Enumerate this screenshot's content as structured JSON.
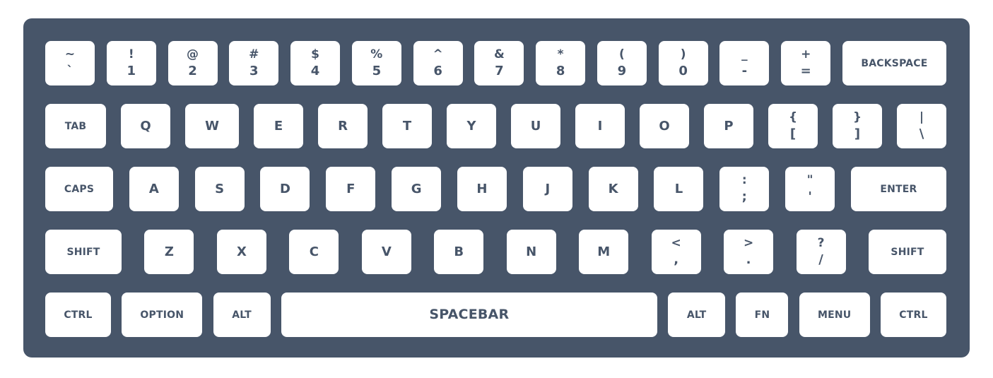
{
  "keyboard": {
    "rows": [
      [
        {
          "top": "~",
          "bottom": "`"
        },
        {
          "top": "!",
          "bottom": "1"
        },
        {
          "top": "@",
          "bottom": "2"
        },
        {
          "top": "#",
          "bottom": "3"
        },
        {
          "top": "$",
          "bottom": "4"
        },
        {
          "top": "%",
          "bottom": "5"
        },
        {
          "top": "^",
          "bottom": "6"
        },
        {
          "top": "&",
          "bottom": "7"
        },
        {
          "top": "*",
          "bottom": "8"
        },
        {
          "top": "(",
          "bottom": "9"
        },
        {
          "top": ")",
          "bottom": "0"
        },
        {
          "top": "_",
          "bottom": "-"
        },
        {
          "top": "+",
          "bottom": "="
        },
        {
          "label": "BACKSPACE"
        }
      ],
      [
        {
          "label": "TAB"
        },
        {
          "label": "Q"
        },
        {
          "label": "W"
        },
        {
          "label": "E"
        },
        {
          "label": "R"
        },
        {
          "label": "T"
        },
        {
          "label": "Y"
        },
        {
          "label": "U"
        },
        {
          "label": "I"
        },
        {
          "label": "O"
        },
        {
          "label": "P"
        },
        {
          "top": "{",
          "bottom": "["
        },
        {
          "top": "}",
          "bottom": "]"
        },
        {
          "top": "|",
          "bottom": "\\"
        }
      ],
      [
        {
          "label": "CAPS"
        },
        {
          "label": "A"
        },
        {
          "label": "S"
        },
        {
          "label": "D"
        },
        {
          "label": "F"
        },
        {
          "label": "G"
        },
        {
          "label": "H"
        },
        {
          "label": "J"
        },
        {
          "label": "K"
        },
        {
          "label": "L"
        },
        {
          "top": ":",
          "bottom": ";"
        },
        {
          "top": "\"",
          "bottom": "'"
        },
        {
          "label": "ENTER"
        }
      ],
      [
        {
          "label": "SHIFT"
        },
        {
          "label": "Z"
        },
        {
          "label": "X"
        },
        {
          "label": "C"
        },
        {
          "label": "V"
        },
        {
          "label": "B"
        },
        {
          "label": "N"
        },
        {
          "label": "M"
        },
        {
          "top": "<",
          "bottom": ","
        },
        {
          "top": ">",
          "bottom": "."
        },
        {
          "top": "?",
          "bottom": "/"
        },
        {
          "label": "SHIFT"
        }
      ],
      [
        {
          "label": "CTRL"
        },
        {
          "label": "OPTION"
        },
        {
          "label": "ALT"
        },
        {
          "label": "SPACEBAR"
        },
        {
          "label": "ALT"
        },
        {
          "label": "FN"
        },
        {
          "label": "MENU"
        },
        {
          "label": "CTRL"
        }
      ]
    ]
  },
  "colors": {
    "board": "#475569",
    "key": "#ffffff",
    "legend": "#475569"
  }
}
